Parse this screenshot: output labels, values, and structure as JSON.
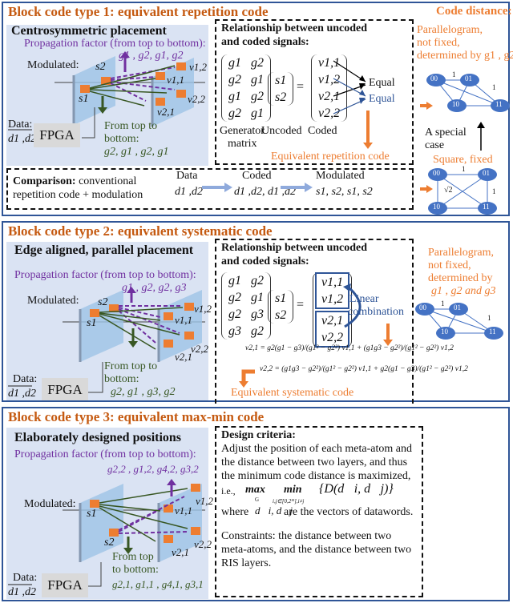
{
  "panel1": {
    "title": "Block code type 1: equivalent repetition code",
    "placement_title": "Centrosymmetric placement",
    "propagation_label": "Propagation factor (from top to bottom):",
    "propagation_values": "g1 , g2, g1, g2",
    "modulated_label": "Modulated:",
    "s1": "s1",
    "s2": "s2",
    "v11": "v1,1",
    "v12": "v1,2",
    "v21": "v2,1",
    "v22": "v2,2",
    "data_label": "Data:",
    "data_values": "d1 ,d2",
    "fpga": "FPGA",
    "from_top_label": "From top to",
    "from_top_label2": "bottom:",
    "from_top_values": "g2, g1 , g2, g1",
    "relationship_title_1": "Relationship between uncoded",
    "relationship_title_2": "and coded signals:",
    "generator_matrix": [
      [
        "g1",
        "g2"
      ],
      [
        "g2",
        "g1"
      ],
      [
        "g1",
        "g2"
      ],
      [
        "g2",
        "g1"
      ]
    ],
    "uncoded_vector": [
      "s1",
      "s2"
    ],
    "coded_vector": [
      "v1,1",
      "v1,2",
      "v2,1",
      "v2,2"
    ],
    "equal_1": "Equal",
    "equal_2": "Equal",
    "generator_label": "Generator",
    "generator_label2": "matrix",
    "uncoded_label": "Uncoded",
    "coded_label": "Coded",
    "equivalent_label": "Equivalent repetition code",
    "comparison_bold": "Comparison:",
    "comparison_text1": " conventional",
    "comparison_text2": "repetition code + modulation",
    "flow": [
      {
        "label": "Data",
        "value": "d1 ,d2"
      },
      {
        "label": "Coded",
        "value": "d1 ,d2, d1 ,d2"
      },
      {
        "label": "Modulated",
        "value": "s1, s2, s1, s2"
      }
    ],
    "code_distance_title": "Code distance:",
    "parallelogram_text1": "Parallelogram,",
    "parallelogram_text2": "not fixed,",
    "parallelogram_text3": "determined by g1 , g2",
    "special_case1": "A special",
    "special_case2": "case",
    "square_text": "Square, fixed",
    "nodes": [
      "00",
      "01",
      "10",
      "11"
    ],
    "edge_label_1": "1",
    "edge_label_sqrt2": "√2"
  },
  "panel2": {
    "title": "Block code type 2: equivalent systematic code",
    "placement_title": "Edge aligned, parallel placement",
    "propagation_label": "Propagation factor (from top to bottom):",
    "propagation_values": "g1 , g2, g2, g3",
    "modulated_label": "Modulated:",
    "s1": "s1",
    "s2": "s2",
    "v11": "v1,1",
    "v12": "v1,2",
    "v21": "v2,1",
    "v22": "v2,2",
    "data_label": "Data:",
    "data_values": "d1 ,d2",
    "fpga": "FPGA",
    "from_top_label": "From top to",
    "from_top_label2": "bottom:",
    "from_top_values": "g2, g1 , g3, g2",
    "relationship_title_1": "Relationship between uncoded",
    "relationship_title_2": "and coded signals:",
    "generator_matrix": [
      [
        "g1",
        "g2"
      ],
      [
        "g2",
        "g1"
      ],
      [
        "g2",
        "g3"
      ],
      [
        "g3",
        "g2"
      ]
    ],
    "uncoded_vector": [
      "s1",
      "s2"
    ],
    "coded_vector": [
      "v1,1",
      "v1,2",
      "v2,1",
      "v2,2"
    ],
    "linear_label1": "Linear",
    "linear_label2": "combination",
    "eq1": "v2,1 = g2(g1 − g3)/(g1² − g2²) v1,1 + (g1g3 − g2²)/(g1² − g2²) v1,2",
    "eq2": "v2,2 = (g1g3 − g2²)/(g1² − g2²) v1,1 + g2(g1 − g3)/(g1² − g2²) v1,2",
    "equivalent_label": "Equivalent systematic code",
    "parallelogram_text1": "Parallelogram,",
    "parallelogram_text2": "not fixed,",
    "parallelogram_text3": "determined by",
    "parallelogram_text4": "g1 , g2 and g3",
    "nodes": [
      "00",
      "01",
      "10",
      "11"
    ],
    "edge_label_1": "1"
  },
  "panel3": {
    "title": "Block code type 3: equivalent max-min code",
    "placement_title": "Elaborately designed positions",
    "propagation_label": "Propagation factor (from top to bottom):",
    "propagation_values": "g2,2 , g1,2, g4,2, g3,2",
    "modulated_label": "Modulated:",
    "s1": "s1",
    "s2": "s2",
    "v11": "v1,1",
    "v12": "v1,2",
    "v21": "v2,1",
    "v22": "v2,2",
    "data_label": "Data:",
    "data_values": "d1 ,d2",
    "fpga": "FPGA",
    "from_top_label": "From top",
    "from_top_label2": "to bottom:",
    "from_top_values": "g2,1, g1,1 , g4,1, g3,1",
    "design_title": "Design criteria:",
    "design_lines": [
      "Adjust the position of each meta-atom and",
      "the distance between two layers, and thus",
      "the minimum code distance is maximized,"
    ],
    "ie_prefix": "i.e.,",
    "max_label": "max",
    "max_sub": "G",
    "min_label": "min",
    "min_sub": "i,j∈[0,2ᴹ],i≠j",
    "objective": "{D(d⃗i, d⃗j)}",
    "where_prefix": "where",
    "where_vars": "d⃗i, d⃗j",
    "where_suffix": "are the vectors of datawords.",
    "constraints_lines": [
      "Constraints: the distance between two",
      "meta-atoms, and the distance between two",
      "RIS layers."
    ]
  }
}
